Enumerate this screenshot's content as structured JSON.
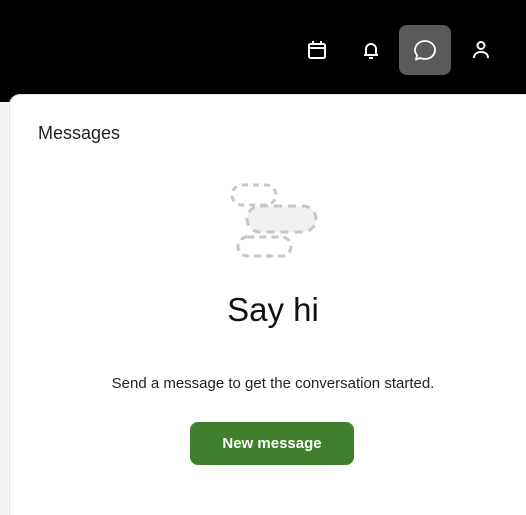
{
  "header": {
    "icons": [
      {
        "name": "calendar-icon",
        "active": false
      },
      {
        "name": "bell-icon",
        "active": false
      },
      {
        "name": "chat-bubble-icon",
        "active": true
      },
      {
        "name": "user-icon",
        "active": false
      }
    ]
  },
  "panel": {
    "title": "Messages",
    "empty_state": {
      "heading": "Say hi",
      "text": "Send a message to get the conversation started.",
      "button_label": "New message"
    }
  },
  "colors": {
    "topbar": "#000000",
    "active_icon_bg": "#5a5a5a",
    "primary_button": "#3f7f2c"
  }
}
